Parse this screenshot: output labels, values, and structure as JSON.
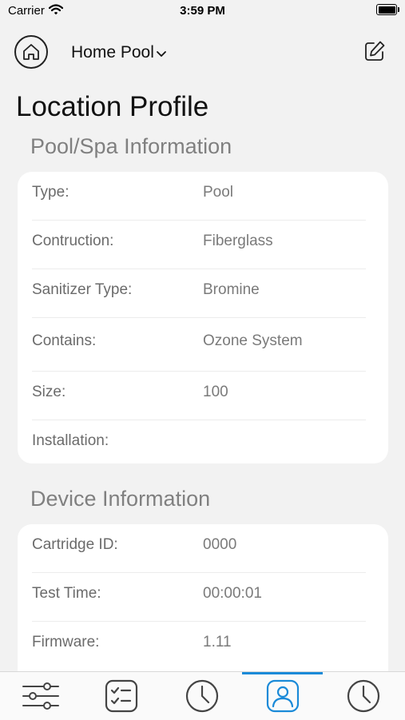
{
  "status_bar": {
    "carrier": "Carrier",
    "time": "3:59 PM"
  },
  "header": {
    "location_name": "Home Pool"
  },
  "page_title": "Location Profile",
  "pool_section": {
    "title": "Pool/Spa Information",
    "rows": [
      {
        "label": "Type:",
        "value": "Pool"
      },
      {
        "label": "Contruction:",
        "value": "Fiberglass"
      },
      {
        "label": "Sanitizer Type:",
        "value": "Bromine"
      },
      {
        "label": "Contains:",
        "value": "Ozone System"
      },
      {
        "label": "Size:",
        "value": "100"
      },
      {
        "label": "Installation:",
        "value": ""
      }
    ]
  },
  "device_section": {
    "title": "Device Information",
    "rows": [
      {
        "label": "Cartridge ID:",
        "value": "0000"
      },
      {
        "label": "Test Time:",
        "value": "00:00:01"
      },
      {
        "label": "Firmware:",
        "value": "1.11"
      }
    ]
  },
  "tab_bar": {
    "active_tab": "profile",
    "accent_color": "#1a8ad8",
    "icons": [
      "sliders-icon",
      "checklist-icon",
      "clock-icon",
      "profile-icon",
      "clock-icon"
    ]
  }
}
